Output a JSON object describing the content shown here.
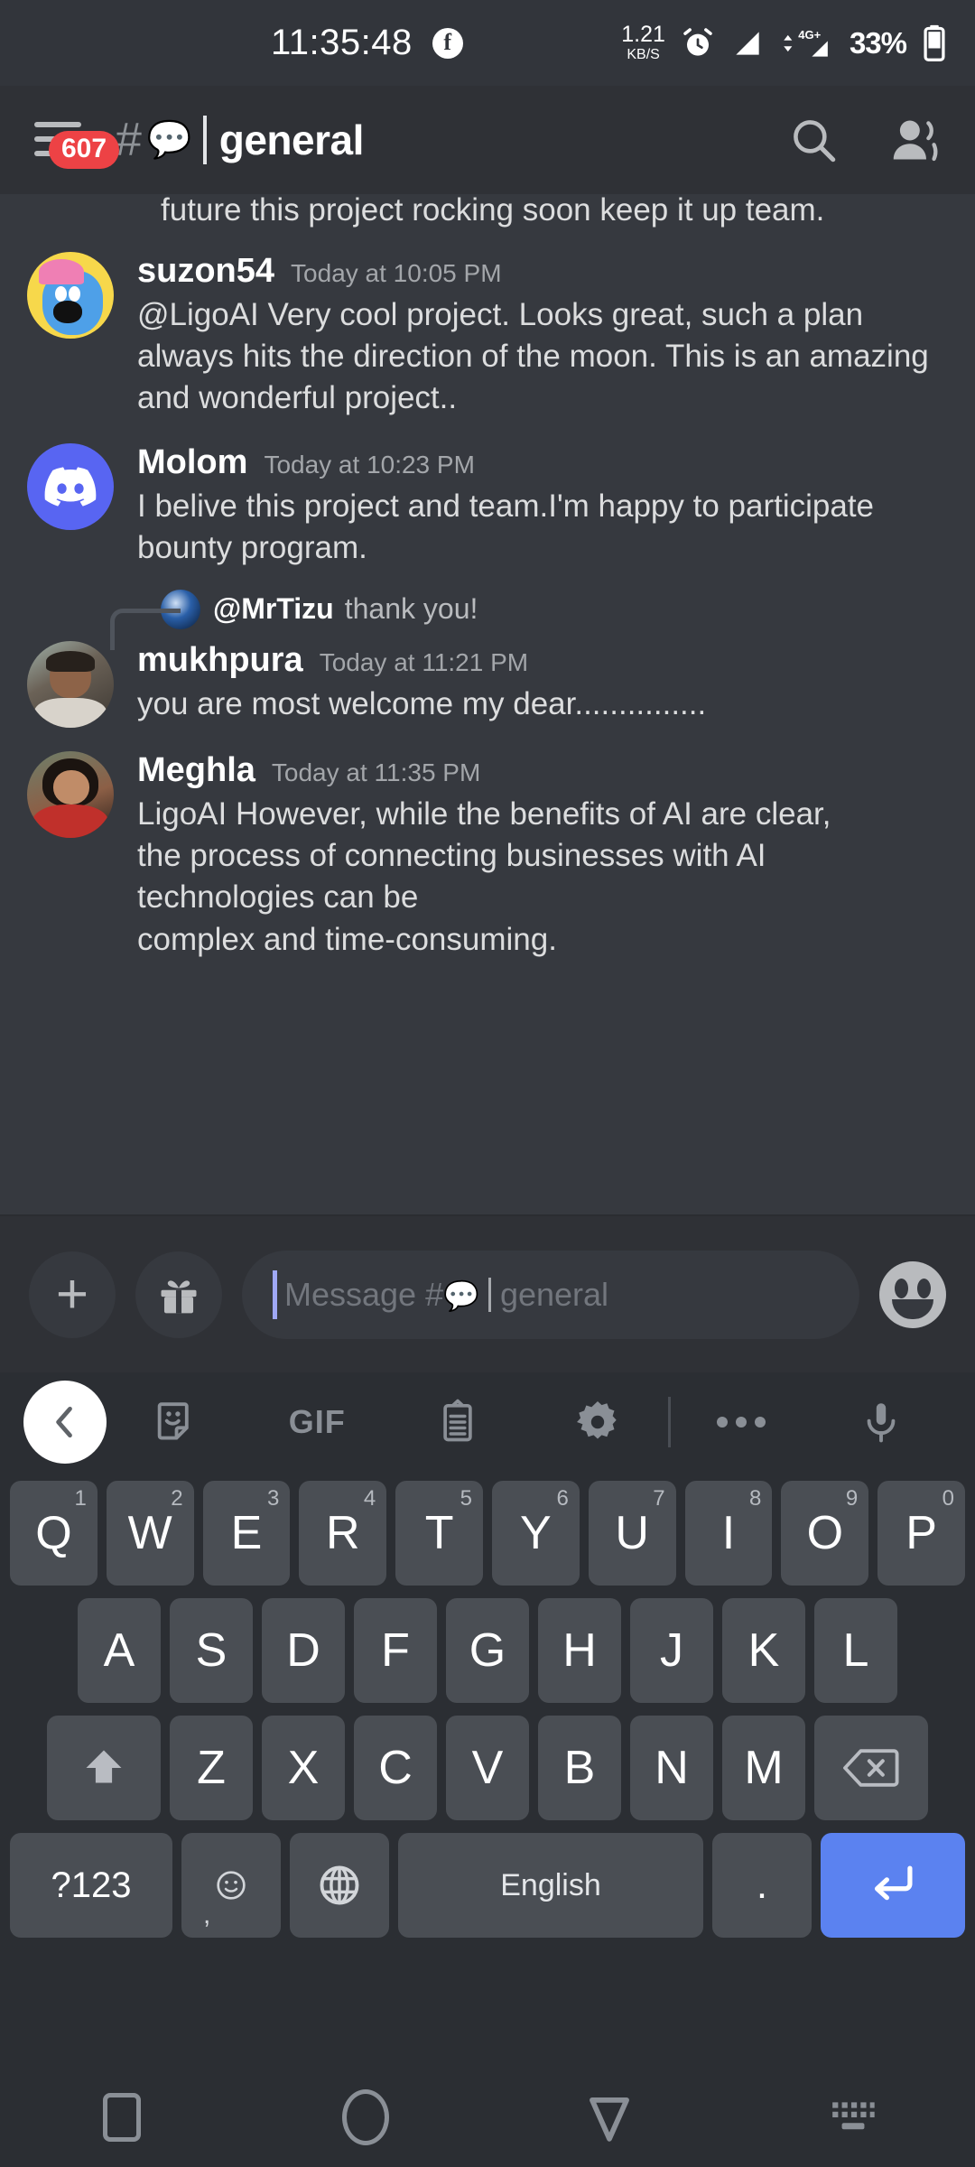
{
  "status_bar": {
    "clock": "11:35:48",
    "app_icon": "facebook-icon",
    "net_speed_value": "1.21",
    "net_speed_unit": "KB/S",
    "icons": [
      "alarm-icon",
      "signal-icon",
      "mobile-data-4g-plus-icon"
    ],
    "network_label": "4G+",
    "battery_percent": "33%"
  },
  "header": {
    "menu_badge": "607",
    "hash": "#",
    "channel_emoji": "💬",
    "channel_title": "general",
    "search_icon": "search-icon",
    "members_icon": "members-icon"
  },
  "messages": {
    "cut_off_text": "future this project rocking soon keep it up team.",
    "list": [
      {
        "author": "suzon54",
        "timestamp": "Today at 10:05 PM",
        "text": "@LigoAI Very cool project. Looks great, such a plan always hits the direction of the moon. This is an amazing and wonderful project.."
      },
      {
        "author": "Molom",
        "timestamp": "Today at 10:23 PM",
        "text": "I belive this project and team.I'm happy to participate bounty program."
      },
      {
        "author": "mukhpura",
        "timestamp": "Today at 11:21 PM",
        "text": "you are most welcome my dear...............",
        "reply_to_author": "@MrTizu",
        "reply_to_text": "thank you!"
      },
      {
        "author": "Meghla",
        "timestamp": "Today at 11:35 PM",
        "text": "LigoAI However, while the benefits of AI are clear,\nthe process of connecting businesses with AI\ntechnologies can be\ncomplex and time-consuming."
      }
    ]
  },
  "input_bar": {
    "add_label": "+",
    "gift_icon": "gift-icon",
    "placeholder_prefix": "Message #",
    "placeholder_emoji": "💬",
    "placeholder_channel": "general",
    "emoji_icon": "emoji-icon"
  },
  "keyboard": {
    "toolbar": {
      "back_icon": "chevron-left-icon",
      "sticker_icon": "sticker-icon",
      "gif_label": "GIF",
      "clipboard_icon": "clipboard-icon",
      "settings_icon": "gear-icon",
      "more_icon": "more-dots-icon",
      "mic_icon": "microphone-icon"
    },
    "row1": [
      {
        "letter": "Q",
        "num": "1"
      },
      {
        "letter": "W",
        "num": "2"
      },
      {
        "letter": "E",
        "num": "3"
      },
      {
        "letter": "R",
        "num": "4"
      },
      {
        "letter": "T",
        "num": "5"
      },
      {
        "letter": "Y",
        "num": "6"
      },
      {
        "letter": "U",
        "num": "7"
      },
      {
        "letter": "I",
        "num": "8"
      },
      {
        "letter": "O",
        "num": "9"
      },
      {
        "letter": "P",
        "num": "0"
      }
    ],
    "row2": [
      "A",
      "S",
      "D",
      "F",
      "G",
      "H",
      "J",
      "K",
      "L"
    ],
    "row3": [
      "Z",
      "X",
      "C",
      "V",
      "B",
      "N",
      "M"
    ],
    "shift_icon": "shift-up-icon",
    "backspace_icon": "backspace-icon",
    "symbols_label": "?123",
    "emoji_key_icon": "emoji-key-icon",
    "comma_label": ",",
    "globe_icon": "globe-icon",
    "space_label": "English",
    "period_label": ".",
    "enter_icon": "enter-icon"
  },
  "nav_bar": {
    "recents_icon": "recents-square-icon",
    "home_icon": "home-circle-icon",
    "back_icon": "back-triangle-icon",
    "hide_keyboard_icon": "hide-keyboard-icon"
  },
  "colors": {
    "accent": "#5865f2",
    "badge_red": "#ed4245",
    "enter_blue": "#5b82f0",
    "chat_bg": "#36393f",
    "chrome_bg": "#2f3136",
    "keyboard_bg": "#2b2e33"
  }
}
